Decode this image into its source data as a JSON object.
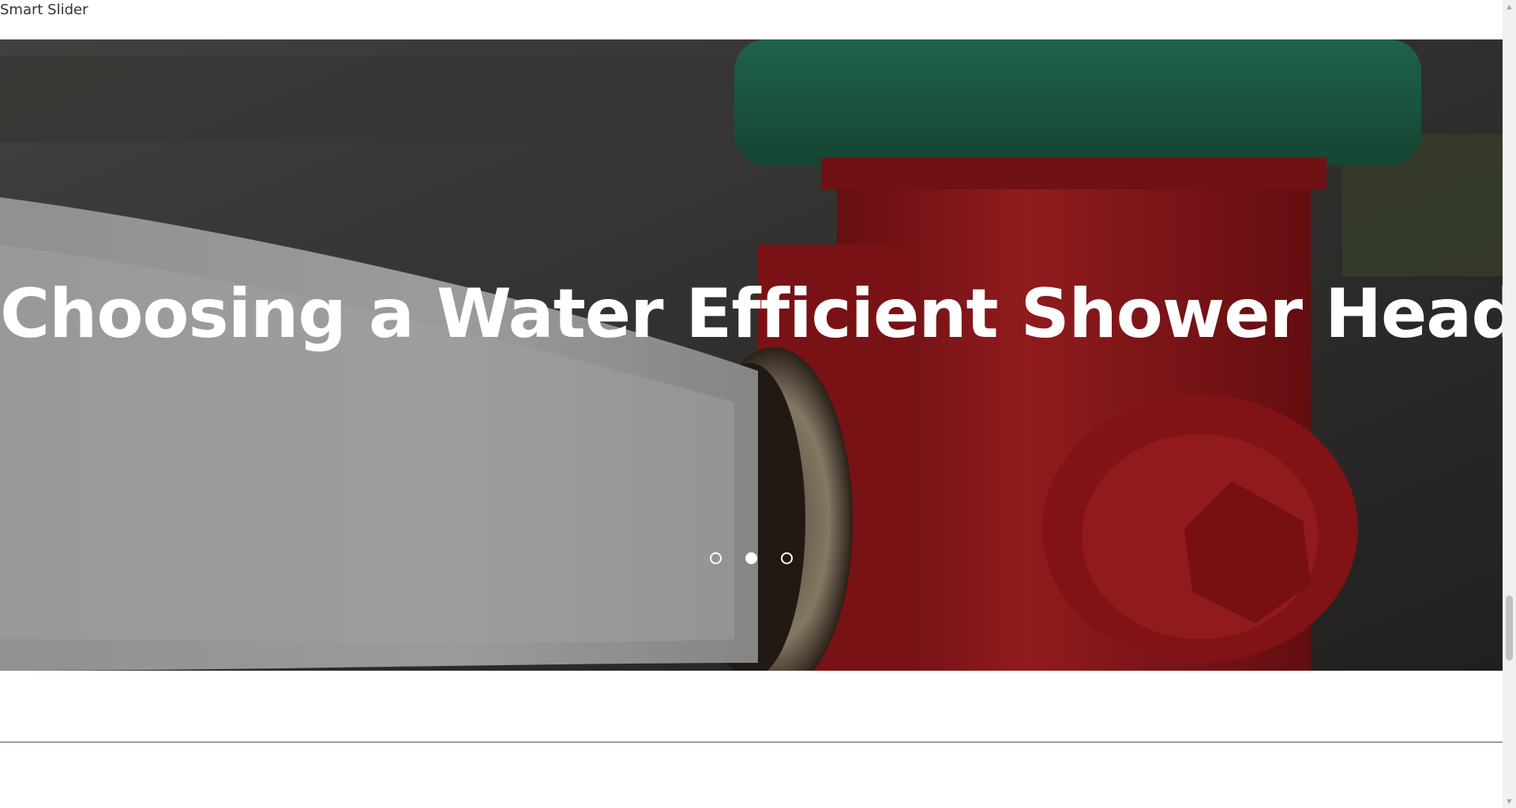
{
  "page": {
    "label": "Smart Slider"
  },
  "slider": {
    "heading": "Choosing a Water Efficient Shower Head",
    "bullets": [
      {
        "state": "inactive"
      },
      {
        "state": "active"
      },
      {
        "state": "inactive"
      }
    ],
    "image": "fire-hydrant-spraying-water"
  },
  "colors": {
    "hydrant_red": "#b01d22",
    "hydrant_green": "#2f7a5c",
    "heading_text": "#ffffff"
  }
}
